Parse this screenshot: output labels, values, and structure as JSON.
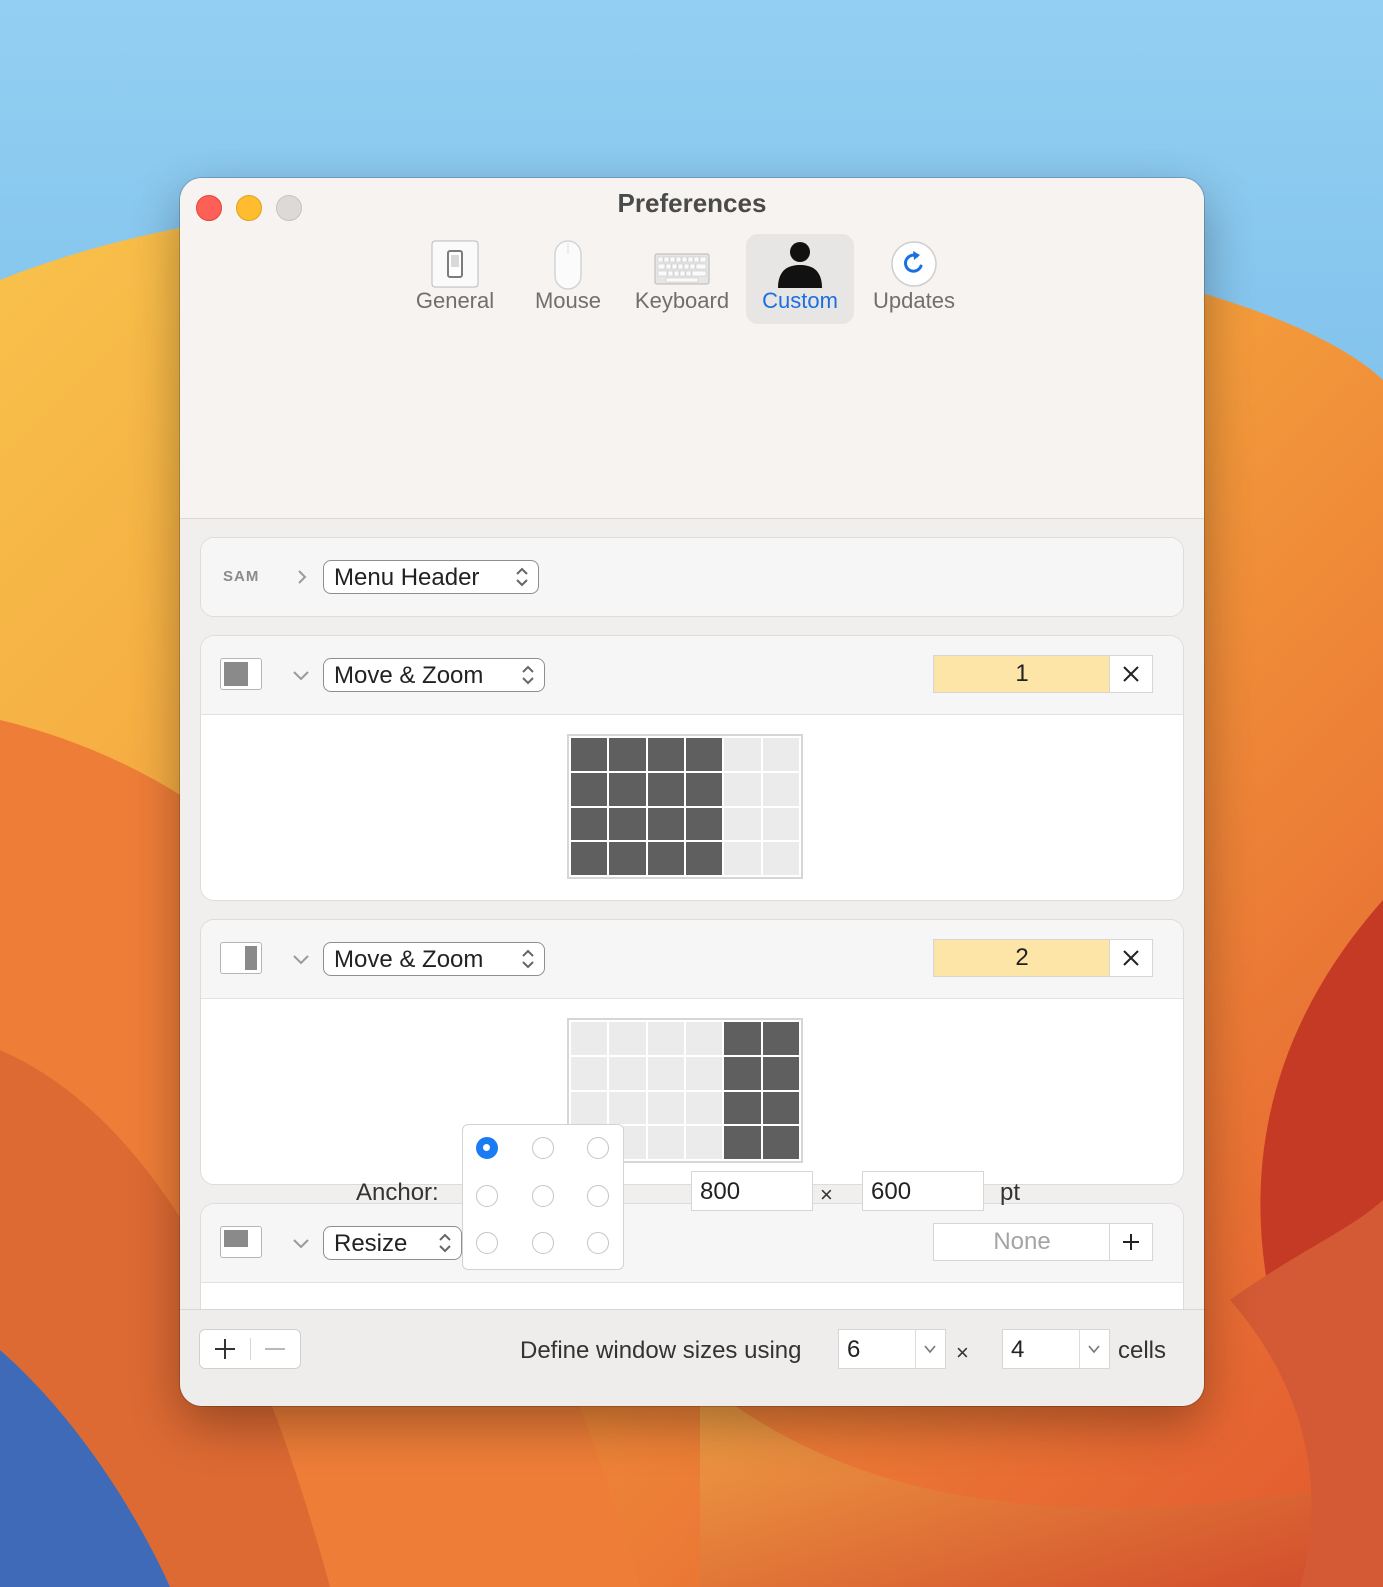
{
  "window": {
    "title": "Preferences"
  },
  "toolbar": {
    "tabs": [
      {
        "label": "General",
        "icon": "switch-icon"
      },
      {
        "label": "Mouse",
        "icon": "mouse-icon"
      },
      {
        "label": "Keyboard",
        "icon": "keyboard-icon"
      },
      {
        "label": "Custom",
        "icon": "person-icon",
        "active": true
      },
      {
        "label": "Updates",
        "icon": "refresh-icon"
      }
    ]
  },
  "colors": {
    "accent": "#1b6fe0",
    "shortcut_bg": "#fde5a8",
    "cell_on": "#5f5f5f",
    "cell_off": "#ebebeb"
  },
  "menu_header": {
    "prefix": "SAM",
    "action": "Menu Header"
  },
  "actions": [
    {
      "action": "Move & Zoom",
      "shortcut": "1",
      "button": "remove",
      "grid_columns": [
        1,
        1,
        1,
        1,
        0,
        0
      ]
    },
    {
      "action": "Move & Zoom",
      "shortcut": "2",
      "button": "remove",
      "grid_columns": [
        0,
        0,
        0,
        0,
        1,
        1
      ]
    },
    {
      "action": "Resize",
      "shortcut": "None",
      "button": "add"
    }
  ],
  "resize": {
    "anchor_label": "Anchor:",
    "anchor_selected": "top-left",
    "width": "800",
    "height": "600",
    "times": "×",
    "unit": "pt"
  },
  "footer": {
    "define_text": "Define window sizes using",
    "columns": "6",
    "times": "×",
    "rows": "4",
    "cells_label": "cells"
  }
}
